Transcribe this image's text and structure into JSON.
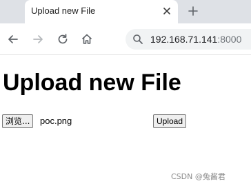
{
  "tab": {
    "title": "Upload new File"
  },
  "toolbar": {
    "url_host": "192.168.71.141",
    "url_port": ":8000"
  },
  "page": {
    "heading": "Upload new File",
    "browse_label": "浏览...",
    "selected_file": "poc.png",
    "upload_label": "Upload"
  },
  "watermark": "CSDN @兔酱君",
  "icons": {
    "tab_close": "close-icon",
    "new_tab": "plus-icon",
    "back": "arrow-left-icon",
    "forward": "arrow-right-icon",
    "reload": "reload-icon",
    "home": "home-icon",
    "search": "search-icon"
  },
  "colors": {
    "tab_strip": "#dee1e6",
    "omnibox": "#f1f3f4",
    "button_bg": "#efefef",
    "button_border": "#767676"
  }
}
